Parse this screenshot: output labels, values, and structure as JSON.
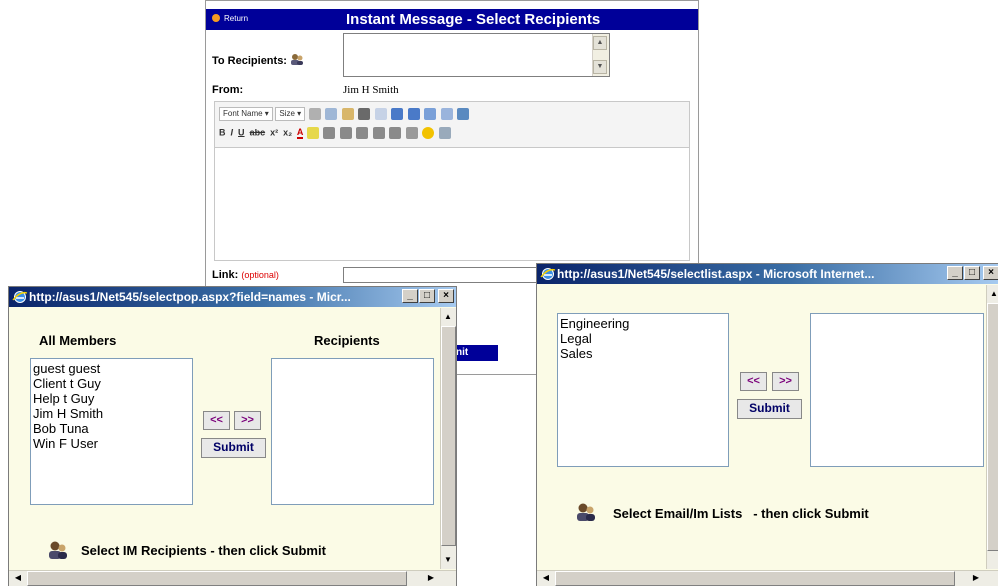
{
  "im_form": {
    "return_label": "Return",
    "title": "Instant Message - Select Recipients",
    "to_label": "To Recipients:",
    "from_label": "From:",
    "from_value": "Jim H Smith",
    "font_name": "Font Name",
    "font_size": "Size",
    "link_label": "Link:",
    "link_optional": "(optional)",
    "submit_partial": "nit"
  },
  "popup_left": {
    "title": "http://asus1/Net545/selectpop.aspx?field=names - Micr...",
    "all_members_header": "All Members",
    "recipients_header": "Recipients",
    "members": [
      "guest guest",
      "Client t Guy",
      "Help t Guy",
      "Jim H Smith",
      "Bob Tuna",
      "Win F User"
    ],
    "move_left_label": "<<",
    "move_right_label": ">>",
    "submit_label": "Submit",
    "hint": "Select IM Recipients - then click Submit"
  },
  "popup_right": {
    "title": "http://asus1/Net545/selectlist.aspx - Microsoft Internet...",
    "lists": [
      "Engineering",
      "Legal",
      "Sales"
    ],
    "move_left_label": "<<",
    "move_right_label": ">>",
    "submit_label": "Submit",
    "hint": "Select Email/Im Lists",
    "hint_suffix": "- then click Submit"
  },
  "window_controls": {
    "minimize": "_",
    "maximize": "□",
    "close": "×"
  },
  "colors": {
    "form_title_bg": "#000099",
    "popup_bg": "#fbfbe6",
    "caption_start": "#0a246a",
    "arrow_text": "#7a007a"
  }
}
